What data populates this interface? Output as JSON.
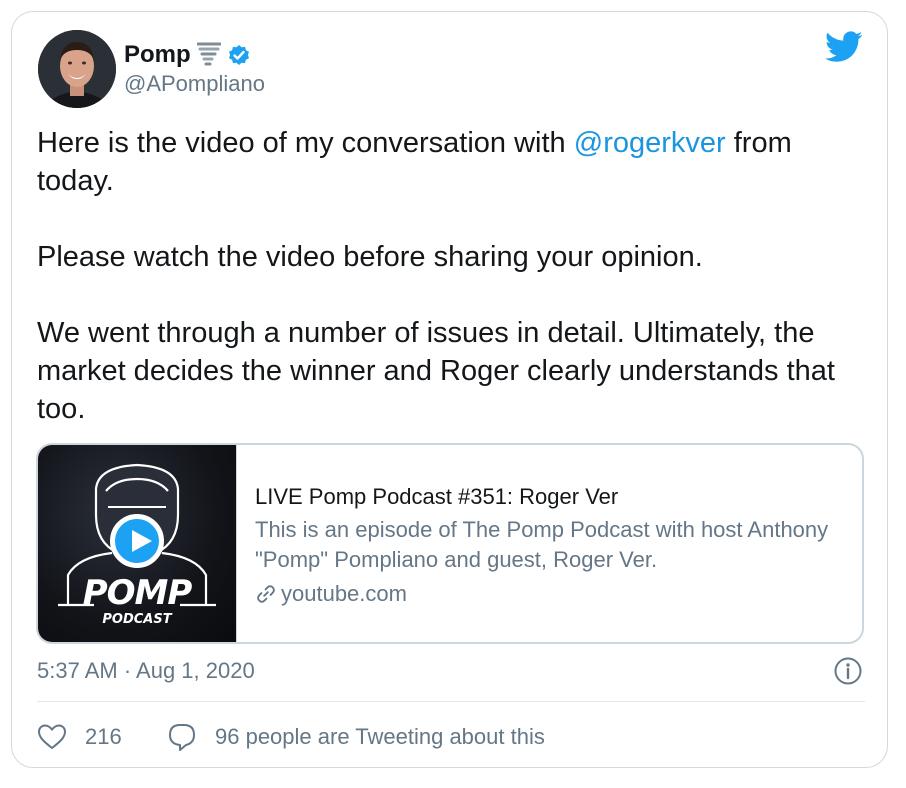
{
  "tweet": {
    "display_name": "Pomp",
    "handle": "@APompliano",
    "text_part1": "Here is the video of my conversation with ",
    "mention": "@rogerkver",
    "text_part2": " from today.",
    "paragraph2": "Please watch the video before sharing your opinion.",
    "paragraph3": "We went through a number of issues in detail. Ultimately, the market decides the winner and Roger clearly understands that too.",
    "timestamp": "5:37 AM · Aug 1, 2020",
    "like_count": "216",
    "conversation_label": "96 people are Tweeting about this"
  },
  "link_card": {
    "title": "LIVE Pomp Podcast #351: Roger Ver",
    "description": "This is an episode of The Pomp Podcast with host Anthony \"Pomp\" Pompliano and guest, Roger Ver.",
    "domain": "youtube.com",
    "thumb_title": "POMP",
    "thumb_subtitle": "PODCAST"
  },
  "icons": {
    "twitter_logo": "twitter-bird-icon",
    "verified": "verified-badge-icon",
    "emoji": "tornado-emoji-icon",
    "link": "link-icon",
    "info": "info-icon",
    "like": "heart-icon",
    "conversation": "speech-bubble-icon",
    "play": "play-icon"
  },
  "colors": {
    "brand_blue": "#1da1f2",
    "mention_blue": "#1b95e0",
    "text_primary": "#14171a",
    "text_secondary": "#657786",
    "border": "#cfd9de"
  }
}
